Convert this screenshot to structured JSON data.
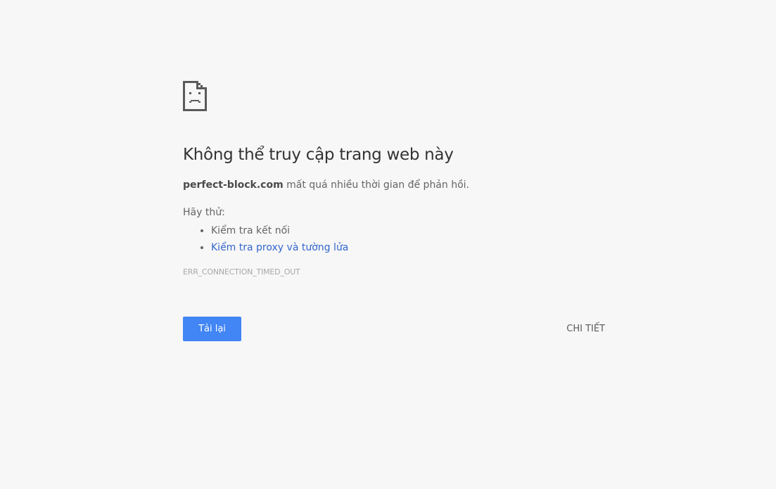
{
  "error": {
    "icon": "sad-page-icon",
    "heading": "Không thể truy cập trang web này",
    "domain": "perfect-block.com",
    "summary_rest": " mất quá nhiều thời gian để phản hồi.",
    "try_label": "Hãy thử:",
    "suggestions": [
      {
        "label": "Kiểm tra kết nối",
        "is_link": false
      },
      {
        "label": "Kiểm tra proxy và tường lửa",
        "is_link": true
      }
    ],
    "code": "ERR_CONNECTION_TIMED_OUT"
  },
  "buttons": {
    "reload_label": "Tải lại",
    "details_label": "CHI TIẾT"
  },
  "colors": {
    "background": "#f7f7f7",
    "primary_button": "#4285f4",
    "link": "#3366cc",
    "heading": "#333333"
  }
}
